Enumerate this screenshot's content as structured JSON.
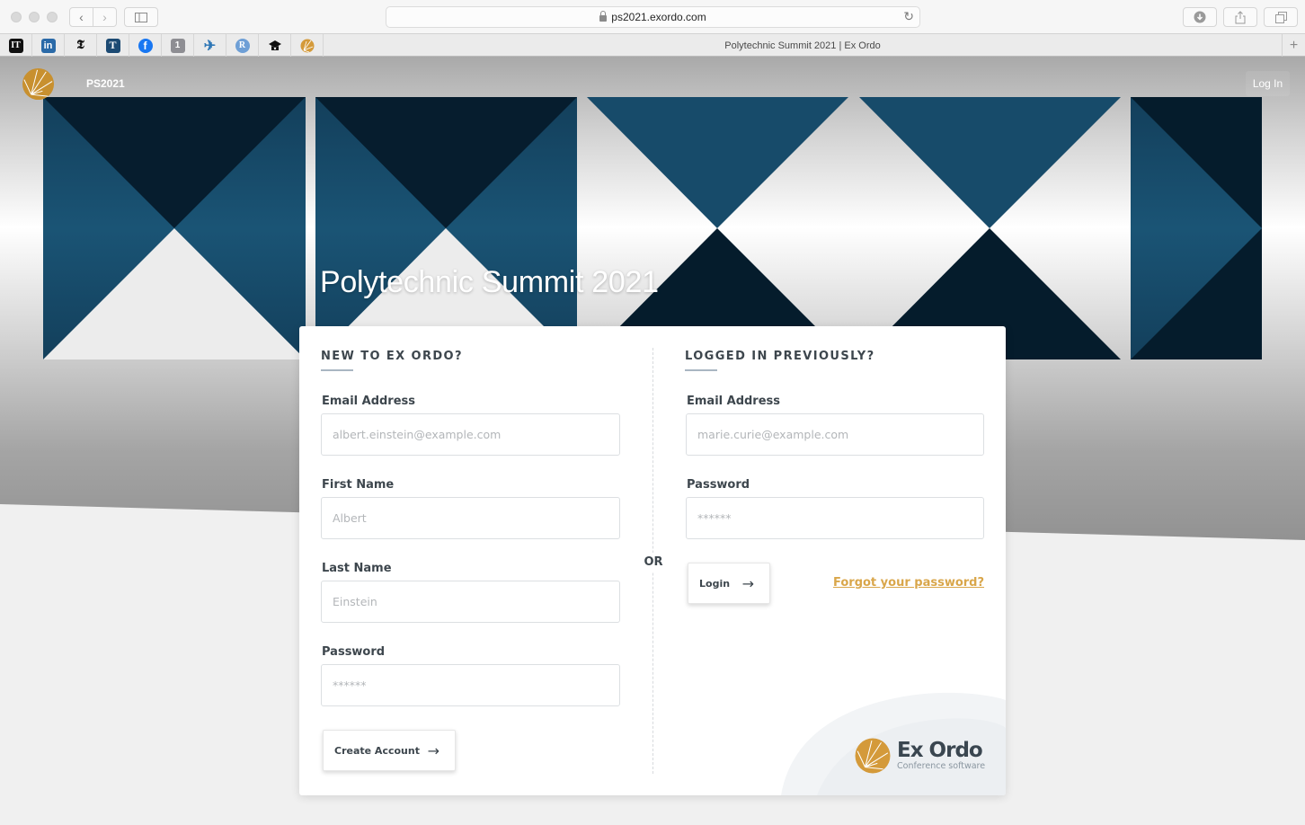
{
  "browser": {
    "url": "ps2021.exordo.com",
    "tab_title": "Polytechnic Summit 2021 | Ex Ordo",
    "favorites": [
      {
        "name": "it-favicon",
        "glyph": "IT",
        "color": "#111111"
      },
      {
        "name": "linkedin-favicon",
        "glyph": "in",
        "color": "#2b6aa8"
      },
      {
        "name": "nytimes-favicon",
        "glyph": "𝕿",
        "color": "#ffffff"
      },
      {
        "name": "t-favicon",
        "glyph": "T",
        "color": "#1c4a73"
      },
      {
        "name": "facebook-favicon",
        "glyph": "f",
        "color": "#1877f2"
      },
      {
        "name": "onepassword-favicon",
        "glyph": "1",
        "color": "#8e8e93"
      },
      {
        "name": "flight-favicon",
        "glyph": "✈",
        "color": "#ffffff"
      },
      {
        "name": "r-favicon",
        "glyph": "R",
        "color": "#6e9fd6"
      },
      {
        "name": "graduation-cap-favicon",
        "glyph": "⌂",
        "color": "#111111"
      },
      {
        "name": "exordo-favicon",
        "glyph": "",
        "color": "#d49a3a"
      }
    ]
  },
  "site": {
    "name": "PS2021",
    "login_link": "Log In",
    "hero_title": "Polytechnic Summit 2021"
  },
  "signup": {
    "heading": "NEW TO EX ORDO?",
    "email_label": "Email Address",
    "email_placeholder": "albert.einstein@example.com",
    "first_name_label": "First Name",
    "first_name_placeholder": "Albert",
    "last_name_label": "Last Name",
    "last_name_placeholder": "Einstein",
    "password_label": "Password",
    "password_placeholder": "******",
    "submit_label": "Create Account"
  },
  "divider_label": "OR",
  "login": {
    "heading": "LOGGED IN PREVIOUSLY?",
    "email_label": "Email Address",
    "email_placeholder": "marie.curie@example.com",
    "password_label": "Password",
    "password_placeholder": "******",
    "submit_label": "Login",
    "forgot_label": "Forgot your password?"
  },
  "brand": {
    "name": "Ex Ordo",
    "tagline": "Conference software"
  },
  "colors": {
    "accent_gold": "#d9a64a",
    "navy_dark": "#051c2c",
    "navy_mid": "#184e6d"
  }
}
